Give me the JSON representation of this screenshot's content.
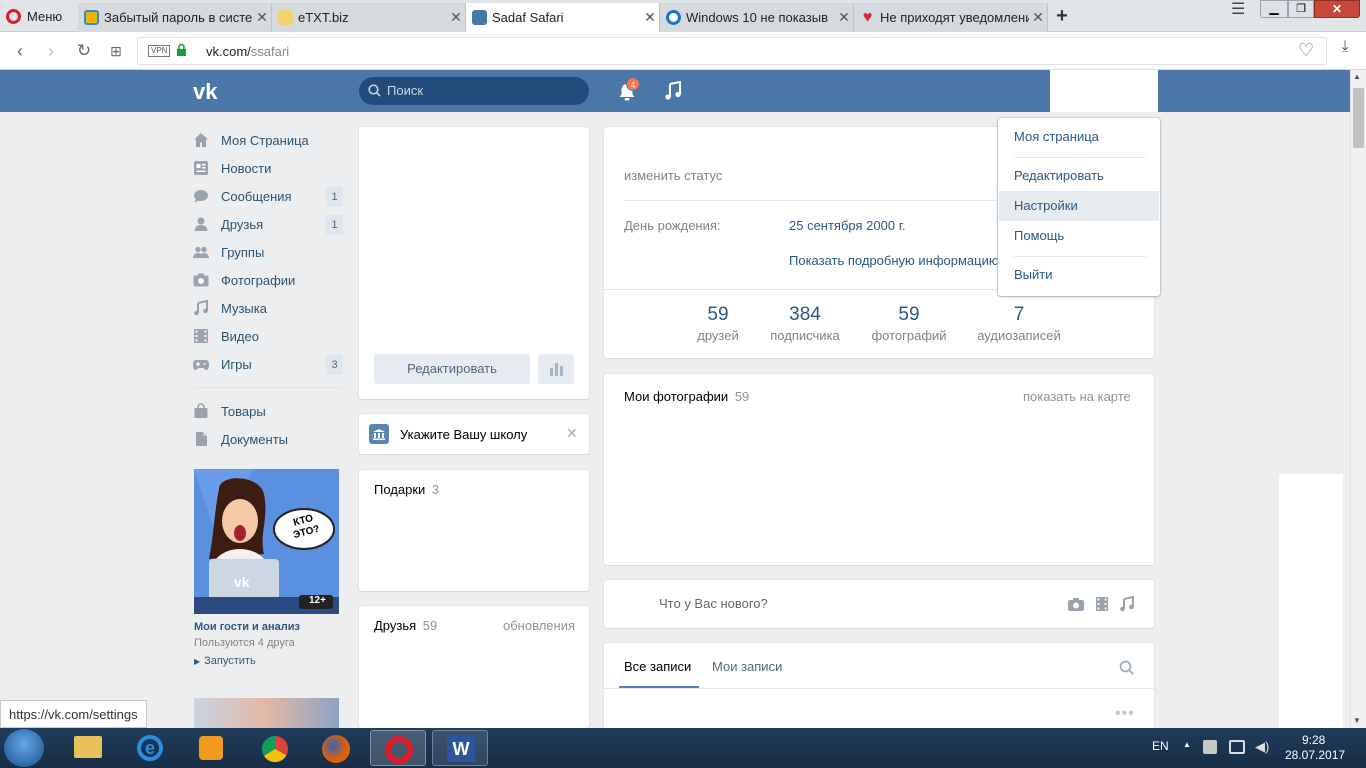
{
  "browser": {
    "menu_label": "Меню",
    "tabs": [
      {
        "label": "Забытый пароль в систе"
      },
      {
        "label": "eTXT.biz"
      },
      {
        "label": "Sadaf Safari"
      },
      {
        "label": "Windows 10 не показыв"
      },
      {
        "label": "Не приходят уведомлени"
      }
    ],
    "vpn_label": "VPN",
    "url_host": "vk.com/",
    "url_path": "ssafari"
  },
  "vk": {
    "search_placeholder": "Поиск",
    "notification_count": "4",
    "menu": [
      {
        "label": "Моя Страница",
        "icon": "home-icon"
      },
      {
        "label": "Новости",
        "icon": "news-icon"
      },
      {
        "label": "Сообщения",
        "icon": "messages-icon",
        "count": "1"
      },
      {
        "label": "Друзья",
        "icon": "friends-icon",
        "count": "1"
      },
      {
        "label": "Группы",
        "icon": "groups-icon"
      },
      {
        "label": "Фотографии",
        "icon": "camera-icon"
      },
      {
        "label": "Музыка",
        "icon": "music-icon"
      },
      {
        "label": "Видео",
        "icon": "video-icon"
      },
      {
        "label": "Игры",
        "icon": "games-icon",
        "count": "3"
      },
      {
        "label": "Товары",
        "icon": "bag-icon"
      },
      {
        "label": "Документы",
        "icon": "document-icon"
      }
    ],
    "ad": {
      "bubble": "КТО ЭТО?",
      "age": "12+",
      "title": "Мои гости и анализ",
      "subtitle": "Пользуются 4 друга",
      "action": "Запустить"
    },
    "status_link": "https://vk.com/settings",
    "edit_button": "Редактировать",
    "school_prompt": "Укажите Вашу школу",
    "gifts": {
      "label": "Подарки",
      "count": "3"
    },
    "friends_block": {
      "label": "Друзья",
      "count": "59",
      "updates": "обновления"
    },
    "profile": {
      "status_placeholder": "изменить статус",
      "birthday_label": "День рождения:",
      "birthday_value": "25 сентября 2000 г.",
      "more_info": "Показать подробную информацию"
    },
    "stats": [
      {
        "value": "59",
        "label": "друзей"
      },
      {
        "value": "384",
        "label": "подписчика"
      },
      {
        "value": "59",
        "label": "фотографий"
      },
      {
        "value": "7",
        "label": "аудиозаписей"
      }
    ],
    "photos": {
      "label": "Мои фотографии",
      "count": "59",
      "map_link": "показать на карте"
    },
    "post_placeholder": "Что у Вас нового?",
    "wall_tabs": {
      "all": "Все записи",
      "mine": "Мои записи"
    },
    "dropdown": [
      {
        "label": "Моя страница"
      },
      {
        "label": "Редактировать"
      },
      {
        "label": "Настройки"
      },
      {
        "label": "Помощь"
      },
      {
        "label": "Выйти"
      }
    ]
  },
  "taskbar": {
    "lang": "EN",
    "time": "9:28",
    "date": "28.07.2017"
  }
}
